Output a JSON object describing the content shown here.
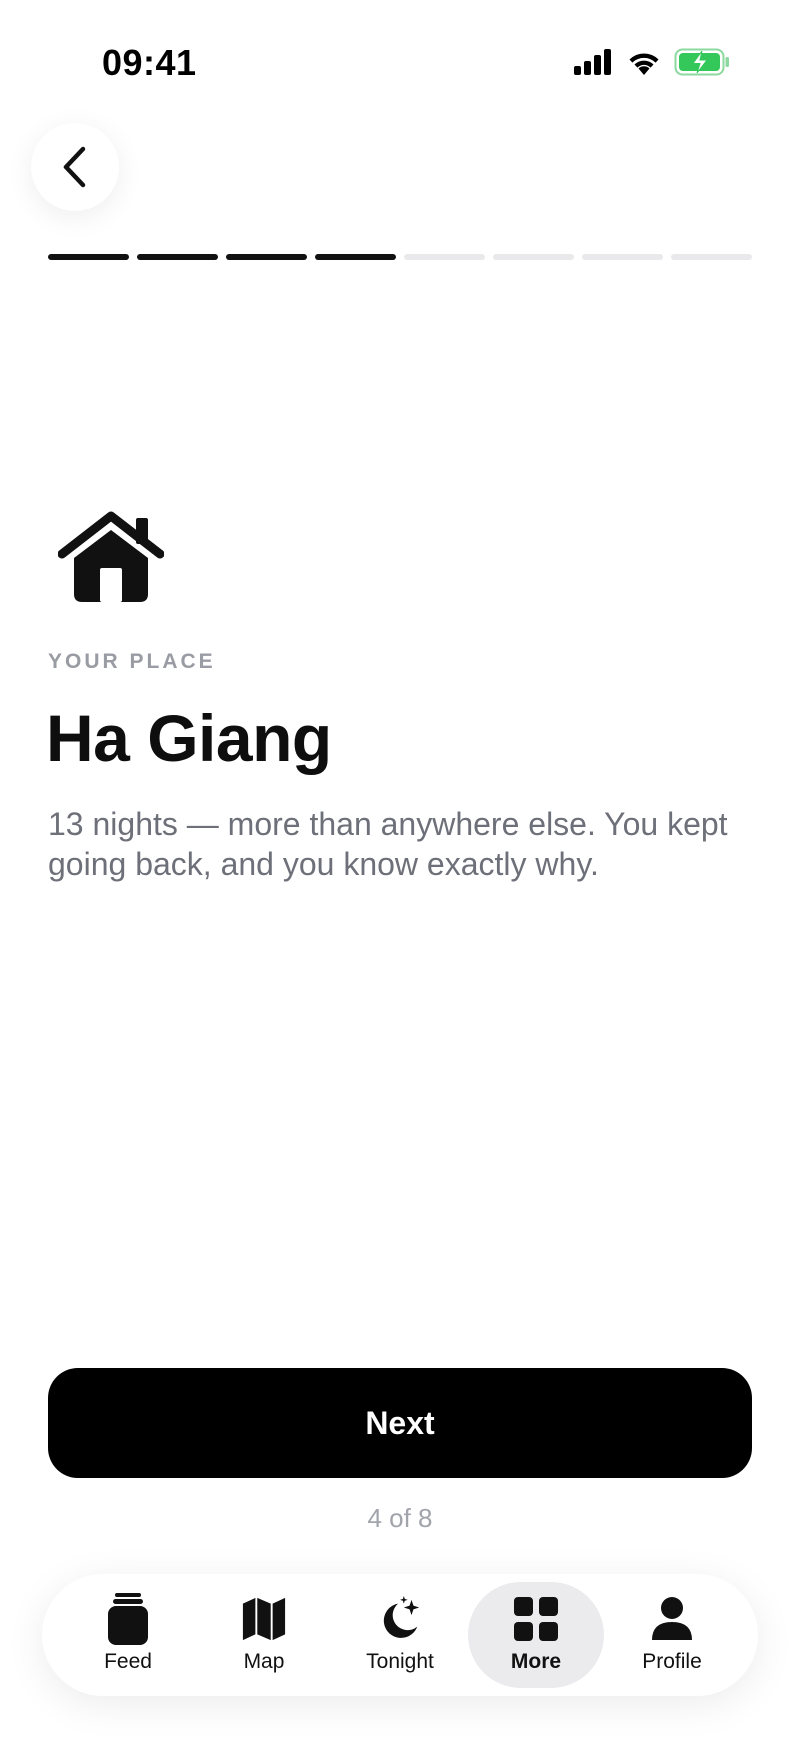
{
  "status_bar": {
    "time": "09:41"
  },
  "onboarding": {
    "progress": {
      "current_step": 4,
      "total_steps": 8
    },
    "eyebrow": "YOUR PLACE",
    "title": "Ha Giang",
    "description": "13 nights — more than anywhere else. You kept going back, and you know exactly why.",
    "icon": "house-icon",
    "next_label": "Next",
    "step_counter": "4 of 8"
  },
  "tab_bar": {
    "active_tab": "More",
    "tabs": [
      {
        "label": "Feed",
        "icon": "jar-icon"
      },
      {
        "label": "Map",
        "icon": "map-icon"
      },
      {
        "label": "Tonight",
        "icon": "moon-stars-icon"
      },
      {
        "label": "More",
        "icon": "grid-icon"
      },
      {
        "label": "Profile",
        "icon": "person-icon"
      }
    ]
  },
  "colors": {
    "primary": "#000000",
    "background": "#ffffff",
    "muted_text": "#6e7079",
    "eyebrow_text": "#9a9ca3",
    "progress_inactive": "#e9e9eb",
    "battery_green": "#34c759",
    "active_tab_bg": "#ebebed"
  }
}
